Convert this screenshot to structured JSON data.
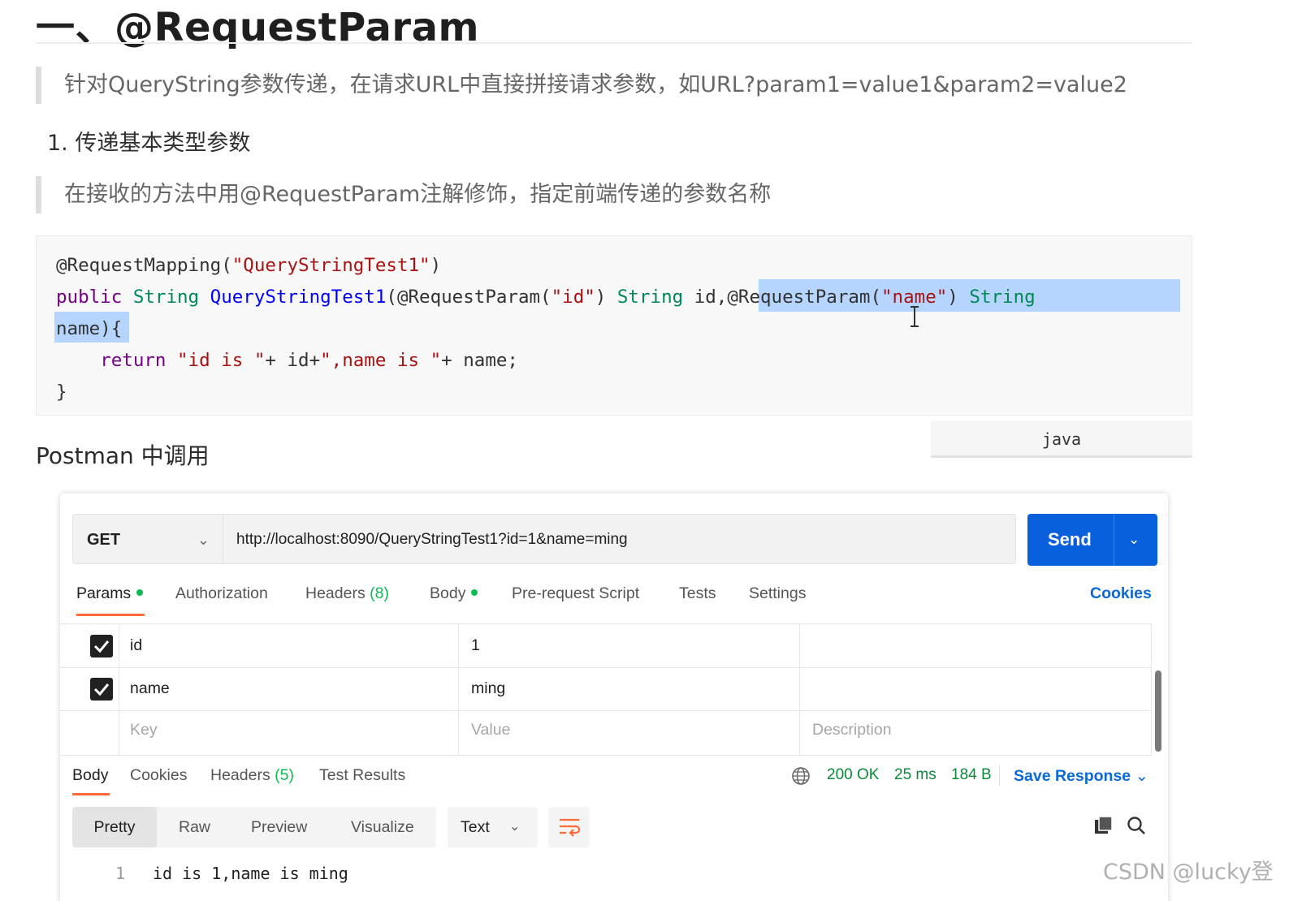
{
  "heading": "一、@RequestParam",
  "quote1": "针对QueryString参数传递，在请求URL中直接拼接请求参数，如URL?param1=value1&param2=value2",
  "subheading": "1. 传递基本类型参数",
  "quote2": "在接收的方法中用@RequestParam注解修饰，指定前端传递的参数名称",
  "code": {
    "l1_a": "@RequestMapping(",
    "l1_b": "\"QueryStringTest1\"",
    "l1_c": ")",
    "l2_kw": "public",
    "l2_ty1": "String",
    "l2_fn": "QueryStringTest1",
    "l2_a": "(@RequestParam(",
    "l2_s1": "\"id\"",
    "l2_b": ")",
    "l2_ty2": "String",
    "l2_c": "id,@RequestParam(",
    "l2_s2": "\"name\"",
    "l2_d": ")",
    "l2_ty3": "String",
    "l3": "name){",
    "l4_kw": "return",
    "l4_s1": "\"id is \"",
    "l4_a": "+ id+",
    "l4_s2": "\",name is \"",
    "l4_b": "+ name;",
    "l5": "}",
    "language": "java"
  },
  "section_title": "Postman 中调用",
  "postman": {
    "method": "GET",
    "url": "http://localhost:8090/QueryStringTest1?id=1&name=ming",
    "send_label": "Send",
    "request_tabs": {
      "params": "Params",
      "authorization": "Authorization",
      "headers": "Headers",
      "headers_count": "(8)",
      "body": "Body",
      "prerequest": "Pre-request Script",
      "tests": "Tests",
      "settings": "Settings"
    },
    "cookies_label": "Cookies",
    "params": [
      {
        "key": "id",
        "value": "1",
        "checked": true
      },
      {
        "key": "name",
        "value": "ming",
        "checked": true
      }
    ],
    "placeholders": {
      "key": "Key",
      "value": "Value",
      "description": "Description"
    },
    "response_tabs": {
      "body": "Body",
      "cookies": "Cookies",
      "headers": "Headers",
      "headers_count": "(5)",
      "test_results": "Test Results"
    },
    "status": "200 OK",
    "time": "25 ms",
    "size": "184 B",
    "save_response": "Save Response",
    "view_modes": [
      "Pretty",
      "Raw",
      "Preview",
      "Visualize"
    ],
    "format": "Text",
    "response_line_number": "1",
    "response_body": "id is 1,name is ming",
    "accent": "#ff6c37",
    "send_color": "#0a5fdc",
    "success_color": "#0cbb52"
  },
  "watermark": "CSDN @lucky登"
}
